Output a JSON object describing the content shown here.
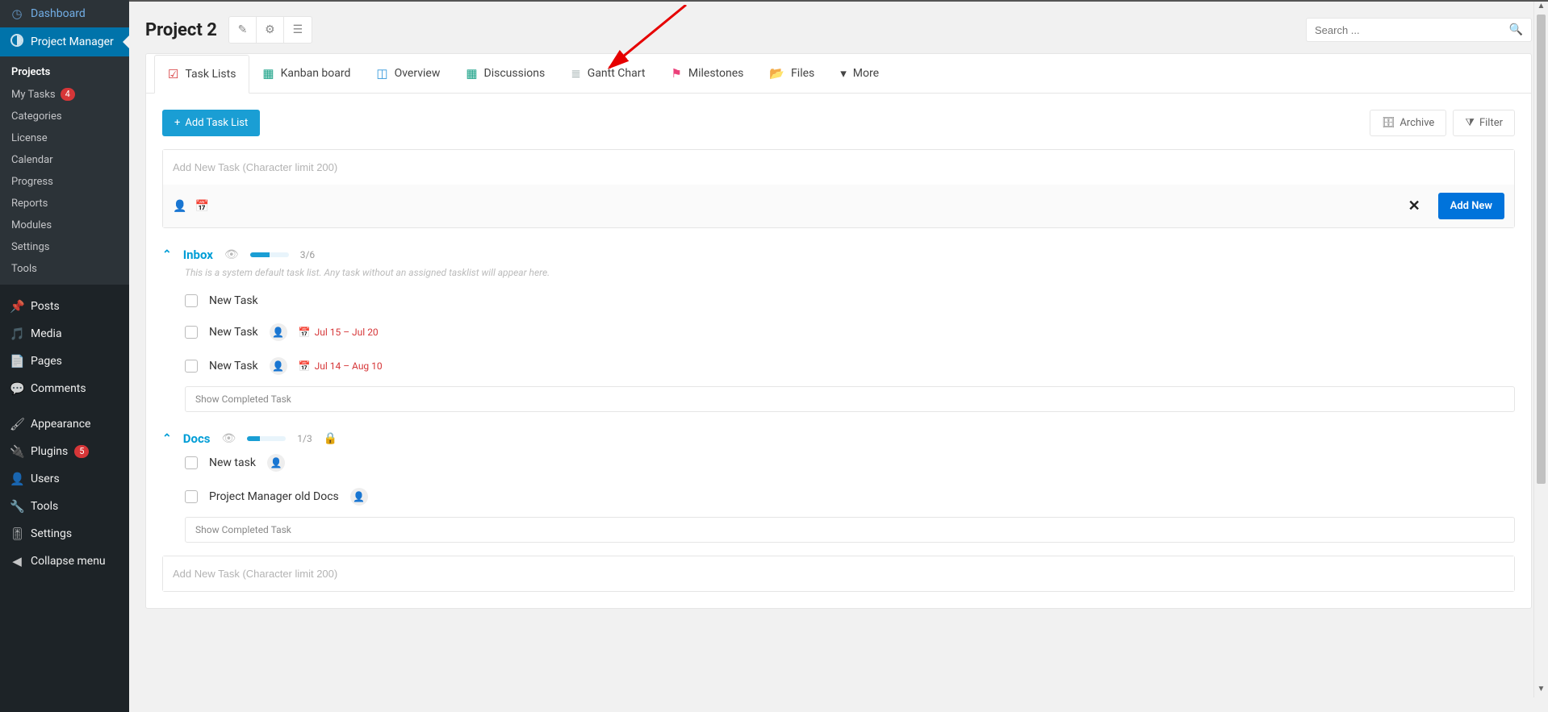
{
  "sidebar": {
    "dashboard": "Dashboard",
    "project_manager": "Project Manager",
    "submenu": {
      "projects": "Projects",
      "my_tasks": "My Tasks",
      "my_tasks_badge": "4",
      "categories": "Categories",
      "license": "License",
      "calendar": "Calendar",
      "progress": "Progress",
      "reports": "Reports",
      "modules": "Modules",
      "settings": "Settings",
      "tools": "Tools"
    },
    "posts": "Posts",
    "media": "Media",
    "pages": "Pages",
    "comments": "Comments",
    "appearance": "Appearance",
    "plugins": "Plugins",
    "plugins_badge": "5",
    "users": "Users",
    "tools": "Tools",
    "settings": "Settings",
    "collapse": "Collapse menu"
  },
  "header": {
    "title": "Project 2",
    "search_placeholder": "Search ..."
  },
  "tabs": {
    "task_lists": "Task Lists",
    "kanban": "Kanban board",
    "overview": "Overview",
    "discussions": "Discussions",
    "gantt": "Gantt Chart",
    "milestones": "Milestones",
    "files": "Files",
    "more": "More"
  },
  "actions": {
    "add_task_list": "Add Task List",
    "archive": "Archive",
    "filter": "Filter",
    "add_new": "Add New",
    "show_completed": "Show Completed Task"
  },
  "newtask": {
    "placeholder": "Add New Task (Character limit 200)"
  },
  "lists": {
    "inbox": {
      "title": "Inbox",
      "count": "3/6",
      "progress_pct": 50,
      "desc": "This is a system default task list. Any task without an assigned tasklist will appear here.",
      "tasks": [
        {
          "name": "New Task"
        },
        {
          "name": "New Task",
          "avatar": true,
          "due": "Jul 15 – Jul 20"
        },
        {
          "name": "New Task",
          "avatar": true,
          "due": "Jul 14 – Aug 10"
        }
      ]
    },
    "docs": {
      "title": "Docs",
      "count": "1/3",
      "progress_pct": 33,
      "locked": true,
      "tasks": [
        {
          "name": "New task",
          "avatar": true
        },
        {
          "name": "Project Manager old Docs",
          "avatar": true
        }
      ]
    }
  }
}
